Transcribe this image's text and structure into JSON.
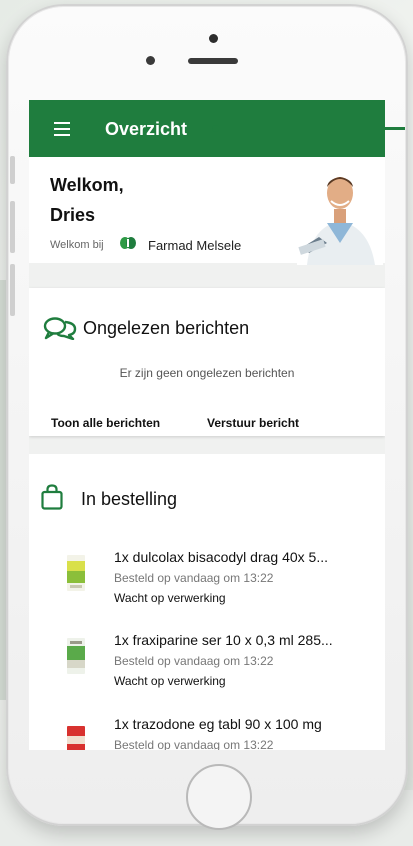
{
  "appbar": {
    "title": "Overzicht"
  },
  "welcome": {
    "greeting": "Welkom,",
    "name": "Dries",
    "at_label": "Welkom bij",
    "pharmacy": "Farmad Melsele"
  },
  "messages": {
    "title": "Ongelezen berichten",
    "empty": "Er zijn geen ongelezen berichten",
    "show_all": "Toon alle berichten",
    "send": "Verstuur bericht"
  },
  "orders": {
    "title": "In bestelling",
    "items": [
      {
        "name": "1x dulcolax bisacodyl drag 40x 5...",
        "date": "Besteld op vandaag om 13:22",
        "status": "Wacht op verwerking"
      },
      {
        "name": "1x fraxiparine ser 10 x 0,3 ml 285...",
        "date": "Besteld op vandaag om 13:22",
        "status": "Wacht op verwerking"
      },
      {
        "name": "1x trazodone eg tabl 90 x 100 mg",
        "date": "Besteld op vandaag om 13:22",
        "status": ""
      }
    ]
  },
  "colors": {
    "primary": "#1f7d3e",
    "background": "#f0f1f0"
  }
}
